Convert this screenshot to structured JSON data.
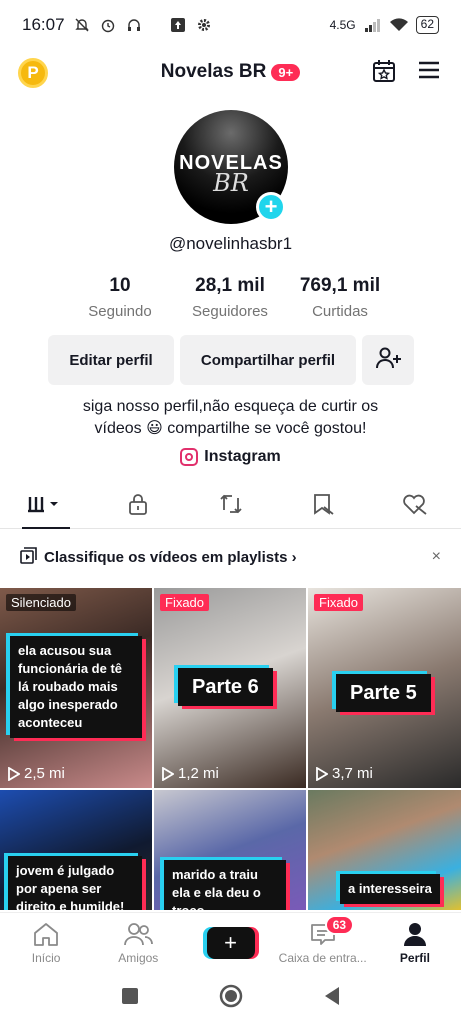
{
  "status": {
    "time": "16:07",
    "network": "4.5G",
    "battery": "62"
  },
  "header": {
    "title": "Novelas BR",
    "badge": "9+",
    "coin_label": "P"
  },
  "avatar": {
    "line1": "NOVELAS",
    "line2": "BR"
  },
  "profile": {
    "username": "@novelinhasbr1",
    "stats": [
      {
        "value": "10",
        "label": "Seguindo"
      },
      {
        "value": "28,1 mil",
        "label": "Seguidores"
      },
      {
        "value": "769,1 mil",
        "label": "Curtidas"
      }
    ],
    "edit_label": "Editar perfil",
    "share_label": "Compartilhar perfil",
    "bio_line1": "siga nosso perfil,não esqueça de curtir os",
    "bio_line2": "vídeos 😃 compartilhe se você gostou!",
    "instagram_label": "Instagram"
  },
  "playlist": {
    "label": "Classifique os vídeos em playlists ›",
    "close": "×"
  },
  "videos": [
    {
      "tag": "Silenciado",
      "caption": "ela acusou sua funcionária de tê lá roubado mais algo inesperado aconteceu",
      "views": "2,5 mi"
    },
    {
      "tag": "Fixado",
      "caption": "Parte 6",
      "views": "1,2 mi"
    },
    {
      "tag": "Fixado",
      "caption": "Parte 5",
      "views": "3,7 mi"
    },
    {
      "caption": "jovem é julgado por apena ser direito e humilde!"
    },
    {
      "caption": "marido a traiu ela e ela deu o troco"
    },
    {
      "caption": "a interesseira"
    }
  ],
  "nav": {
    "home": "Início",
    "friends": "Amigos",
    "create": "+",
    "inbox": "Caixa de entra...",
    "inbox_badge": "63",
    "profile": "Perfil"
  },
  "colors": {
    "accent": "#fe2c55",
    "cyan": "#29d0f0"
  }
}
